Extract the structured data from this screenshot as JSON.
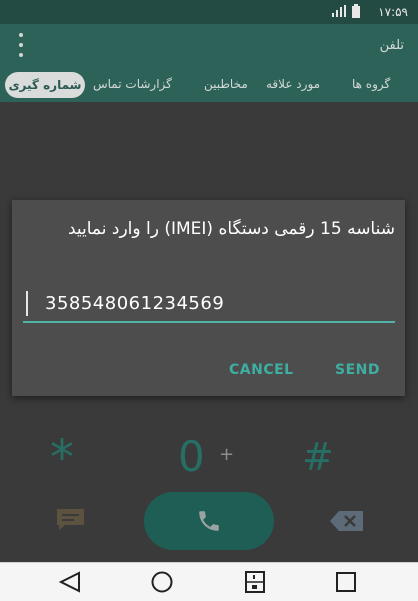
{
  "status_bar": {
    "time": "۱۷:۵۹"
  },
  "app_bar": {
    "title": "تلفن"
  },
  "tabs": {
    "active": "شماره گیری",
    "items": [
      "گزارشات تماس",
      "مخاطبین",
      "مورد علاقه",
      "گروه ها"
    ]
  },
  "dialog": {
    "message": "شناسه 15 رقمی دستگاه (IMEI) را وارد نمایید",
    "input_value": "358548061234569",
    "cancel_label": "CANCEL",
    "send_label": "SEND"
  },
  "keypad": {
    "star": "*",
    "zero": "0",
    "plus": "+",
    "hash": "#"
  },
  "icons": {
    "chat": "chat-icon",
    "call": "phone-icon",
    "backspace": "backspace-icon",
    "back": "back-icon",
    "home": "home-icon",
    "dual_sim": "dual-sim-icon",
    "recents": "recents-icon"
  },
  "colors": {
    "app_bar": "#2d6259",
    "accent": "#3eaea2",
    "dialog_bg": "#4d4d4d",
    "call_button": "#1e5e55"
  }
}
